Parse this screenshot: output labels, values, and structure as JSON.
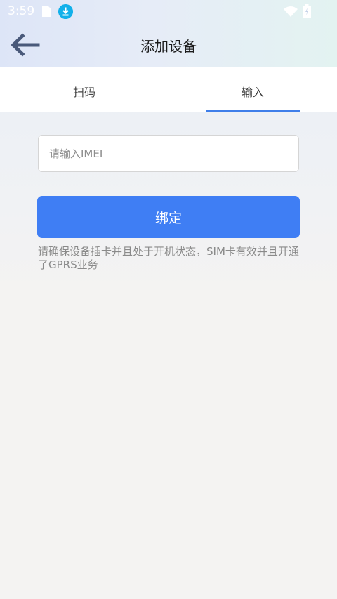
{
  "status_bar": {
    "time": "3:59",
    "icons": [
      "sim-card-icon",
      "download-icon",
      "wifi-icon",
      "battery-icon"
    ],
    "download_icon_color": "#12b0ea"
  },
  "app_bar": {
    "back_icon": "arrow-left-icon",
    "title": "添加设备"
  },
  "tabs": [
    {
      "label": "扫码",
      "selected": false
    },
    {
      "label": "输入",
      "selected": true
    }
  ],
  "form": {
    "imei_placeholder": "请输入IMEI",
    "imei_value": "",
    "bind_label": "绑定",
    "hint": "请确保设备插卡并且处于开机状态，SIM卡有效并且开通了GPRS业务"
  },
  "colors": {
    "accent": "#3f7ef4",
    "tab_indicator": "#3f7ee9",
    "back_arrow": "#49597a",
    "hint_text": "#8a8a8a"
  }
}
